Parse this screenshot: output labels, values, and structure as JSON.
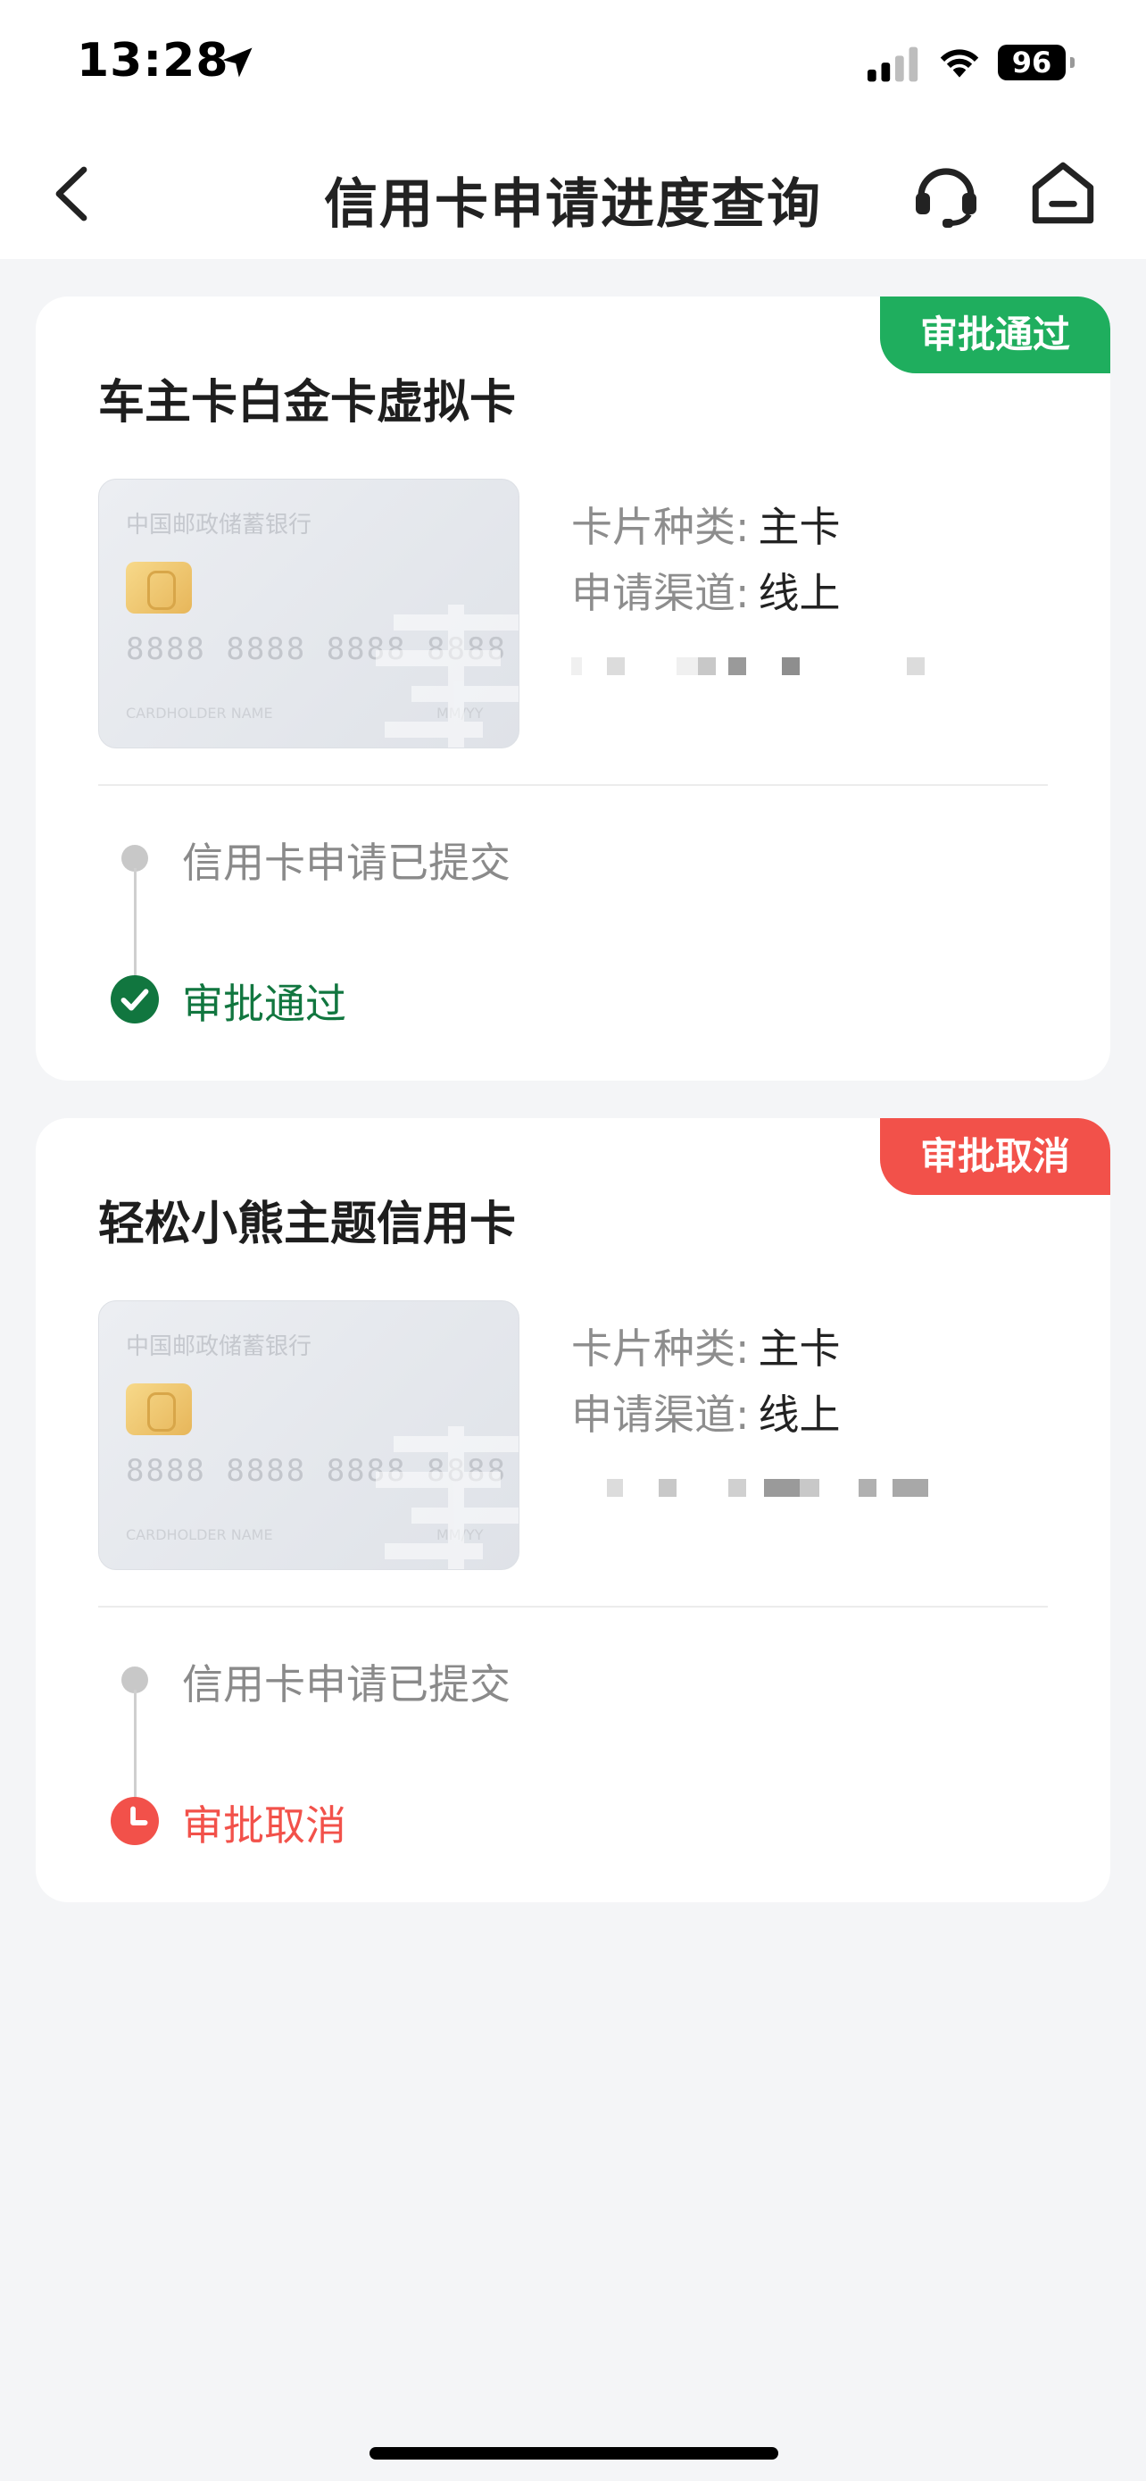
{
  "status_bar": {
    "time": "13:28",
    "battery": "96"
  },
  "nav": {
    "title": "信用卡申请进度查询"
  },
  "colors": {
    "approved": "#1fae5e",
    "approved_text": "#11763f",
    "cancelled": "#f2514a"
  },
  "card_image": {
    "bank": "中国邮政储蓄银行",
    "number": "8888 8888 8888 8888",
    "holder": "CARDHOLDER NAME",
    "expiry": "MM/YY"
  },
  "applications": [
    {
      "title": "车主卡白金卡虚拟卡",
      "badge": "审批通过",
      "card_type_label": "卡片种类:",
      "card_type": "主卡",
      "channel_label": "申请渠道:",
      "channel": "线上",
      "steps": [
        {
          "text": "信用卡申请已提交"
        },
        {
          "text": "审批通过"
        }
      ]
    },
    {
      "title": "轻松小熊主题信用卡",
      "badge": "审批取消",
      "card_type_label": "卡片种类:",
      "card_type": "主卡",
      "channel_label": "申请渠道:",
      "channel": "线上",
      "steps": [
        {
          "text": "信用卡申请已提交"
        },
        {
          "text": "审批取消"
        }
      ]
    }
  ]
}
